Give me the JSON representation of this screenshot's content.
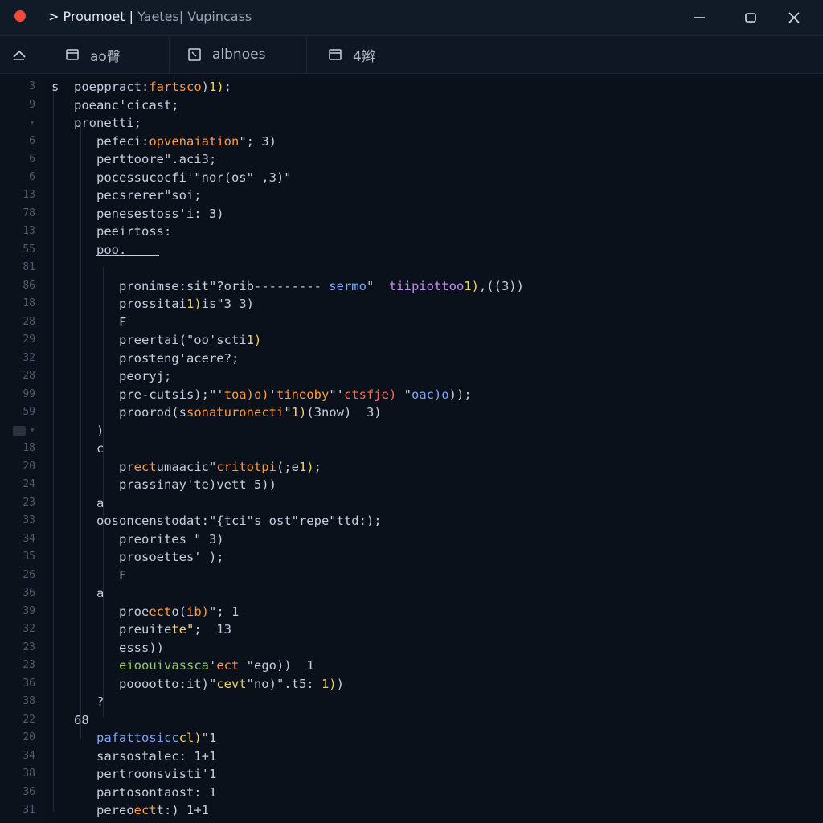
{
  "window": {
    "title_prefix": "> Proumoet |",
    "title_rest": " Yaetes| Vupincass"
  },
  "tabs": [
    {
      "label": "ao臀"
    },
    {
      "label": "albnoes"
    },
    {
      "label": "4辫"
    }
  ],
  "line_numbers": [
    "3",
    "9",
    "",
    "6",
    "6",
    "6",
    "13",
    "78",
    "13",
    "55",
    "81",
    "86",
    "18",
    "28",
    "29",
    "32",
    "28",
    "99",
    "59",
    "",
    "18",
    "20",
    "24",
    "23",
    "33",
    "34",
    "35",
    "26",
    "36",
    "39",
    "32",
    "23",
    "23",
    "36",
    "38",
    "22",
    "20",
    "34",
    "38",
    "36",
    "31"
  ],
  "code_lines": [
    "s  poeppract:fartsco)1);",
    "   poeanc'cicast;",
    "   pronetti;",
    "      pefeci:opvenaiation\"; 3)",
    "      perttoore\".aci3;",
    "      pocessucocfi'\"nor(os\" ,3)\"",
    "      pecsrerer\"soi;",
    "      penesestoss'i: 3)",
    "      peeirtoss:",
    "      poo.",
    "",
    "         pronimse:sit\"?orib--------- sermo\"  tiipiottoo1),((3))",
    "         prossitai1)is\"3 3)",
    "         F",
    "         preertai(\"oo'scti1)",
    "         prosteng'acere?;",
    "         peoryj;",
    "         pre-cutsis);\"'toa)o)'tineoby\"'ctsfje) \"oac)o));",
    "         proorod(ssonaturonecti\"1)(3now)  3)",
    "      )",
    "      c",
    "         prectumaacic\"critotpi(;e1);",
    "         prassinay'te)vett 5))",
    "      a",
    "      oosoncenstodat:\"{tci\"s ost\"repe\"ttd:);",
    "         preorites \" 3)",
    "         prosoettes' );",
    "         F",
    "      a",
    "         proeecto(ib)\"; 1",
    "         preuitete\";  13",
    "         esss))",
    "         eioouivassca'ect \"ego))  1",
    "         pooootto:it)\"cevt\"no)\".t5: 1))",
    "      ?",
    "   68",
    "      pafattosicccl)\"1",
    "      sarsostalec: 1+1",
    "      pertroonsvisti'1",
    "      partosontaost: 1",
    "      pereoectt:) 1+1"
  ],
  "colors": {
    "accent_orange": "#ff9a3d",
    "accent_yellow": "#f1d35a",
    "accent_green": "#93c96b",
    "accent_blue": "#7aa7ff",
    "close_dot": "#f04a3c"
  },
  "icons": {
    "back": "up-arrow-icon",
    "tab1": "window-icon",
    "tab2": "square-icon",
    "tab3": "panel-icon",
    "minimize": "minimize-icon",
    "maximize": "maximize-icon",
    "close": "close-icon"
  }
}
